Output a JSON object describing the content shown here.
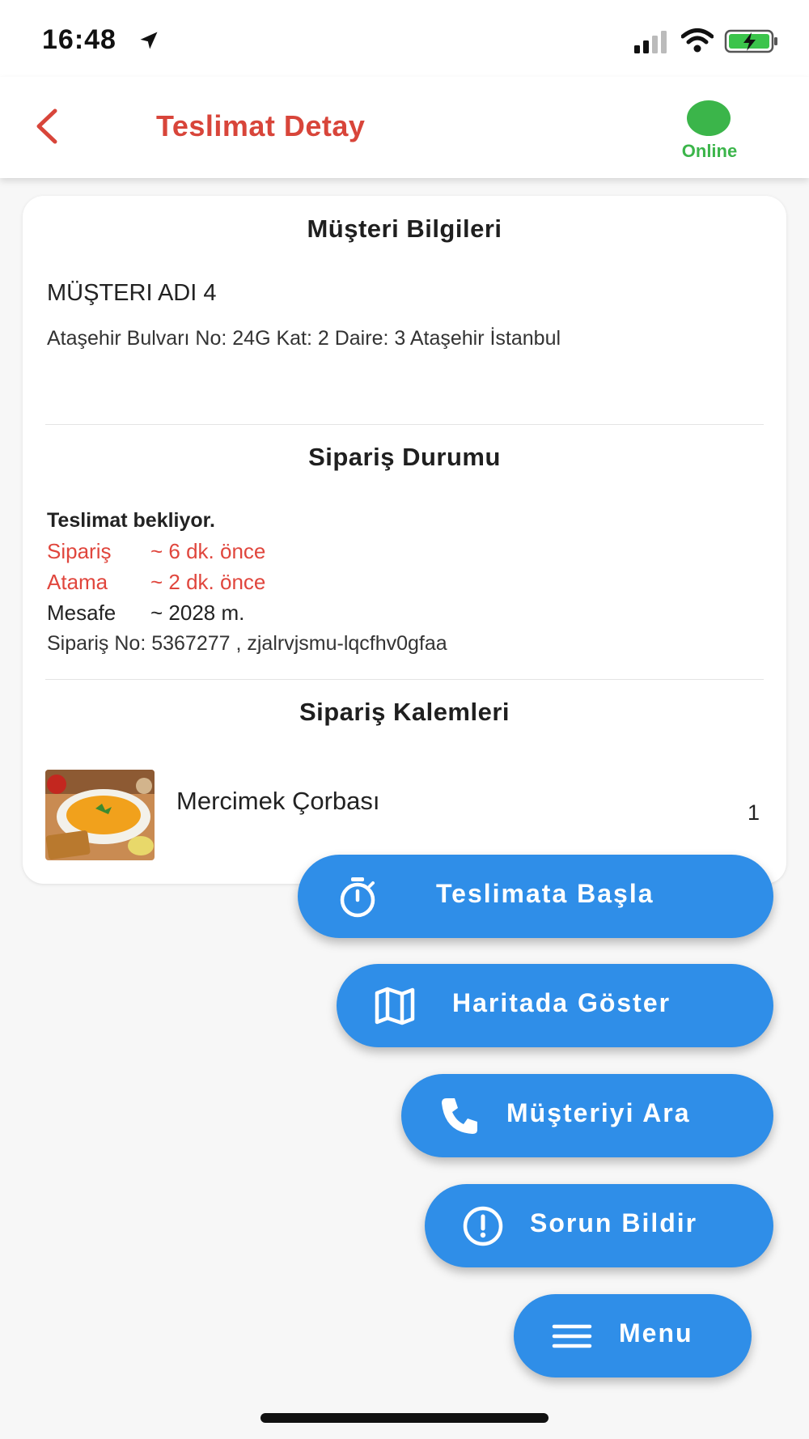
{
  "status_bar": {
    "time": "16:48",
    "icons": [
      "location-arrow-icon",
      "signal-icon",
      "wifi-icon",
      "battery-charging-icon"
    ]
  },
  "app_bar": {
    "title": "Teslimat Detay",
    "status_label": "Online",
    "status_color": "#3bb54a",
    "accent_color": "#d8453a"
  },
  "customer": {
    "section_title": "Müşteri Bilgileri",
    "name": "MÜŞTERI ADI 4",
    "address": "Ataşehir Bulvarı No: 24G Kat: 2 Daire: 3 Ataşehir İstanbul"
  },
  "order_status": {
    "section_title": "Sipariş Durumu",
    "status": "Teslimat bekliyor.",
    "ordered_label": "Sipariş",
    "ordered_value": "~ 6 dk. önce",
    "assigned_label": "Atama",
    "assigned_value": "~ 2 dk. önce",
    "distance_label": "Mesafe",
    "distance_value": "~ 2028 m.",
    "order_no": "Sipariş No: 5367277 , zjalrvjsmu-lqcfhv0gfaa"
  },
  "order_items": {
    "section_title": "Sipariş Kalemleri",
    "items": [
      {
        "name": "Mercimek Çorbası",
        "quantity": "1",
        "image": "lentil-soup-photo"
      }
    ]
  },
  "actions": {
    "start_delivery": "Teslimata Başla",
    "show_on_map": "Haritada Göster",
    "call_customer": "Müşteriyi Ara",
    "report_issue": "Sorun Bildir",
    "menu": "Menu",
    "button_color": "#2f8ee8"
  }
}
